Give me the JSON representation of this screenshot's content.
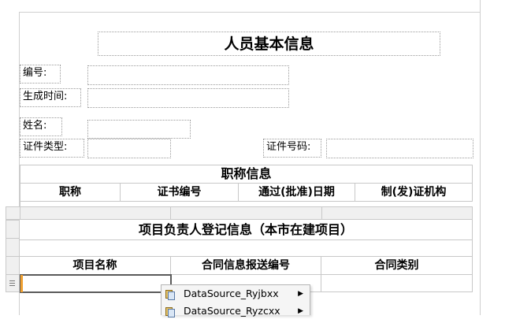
{
  "report": {
    "title": "人员基本信息",
    "fields": {
      "number_label": "编号:",
      "created_time_label": "生成时间:",
      "name_label": "姓名:",
      "id_type_label": "证件类型:",
      "id_number_label": "证件号码:"
    },
    "title_section": {
      "heading": "职称信息",
      "columns": [
        "职称",
        "证书编号",
        "通过(批准)日期",
        "制(发)证机构"
      ]
    },
    "project_section": {
      "heading": "项目负责人登记信息（本市在建项目）",
      "columns": [
        "项目名称",
        "合同信息报送编号",
        "合同类别"
      ]
    }
  },
  "context_menu": {
    "items": [
      {
        "label": "DataSource_Ryjbxx",
        "icon": "datasource-icon"
      },
      {
        "label": "DataSource_Ryzcxx",
        "icon": "datasource-icon"
      }
    ]
  }
}
